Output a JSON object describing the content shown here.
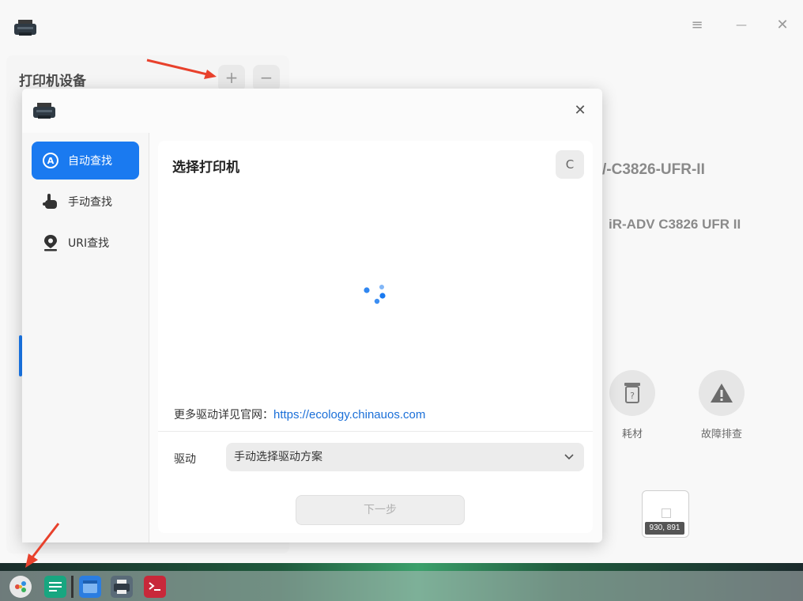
{
  "main_window": {
    "panel_title": "打印机设备",
    "add_label": "+",
    "remove_label": "−",
    "controls": {
      "menu": "≡",
      "minimize": "—",
      "close": "✕"
    },
    "background_model_line1": "/-C3826-UFR-II",
    "background_model_line2": "iR-ADV C3826 UFR II",
    "actions": [
      {
        "label": "耗材",
        "icon": "cartridge-icon"
      },
      {
        "label": "故障排查",
        "icon": "warning-icon"
      }
    ],
    "coord_readout": "930, 891"
  },
  "dialog": {
    "close_label": "✕",
    "nav": [
      {
        "label": "自动查找",
        "icon": "auto-search-icon",
        "active": true
      },
      {
        "label": "手动查找",
        "icon": "hand-pointer-icon",
        "active": false
      },
      {
        "label": "URI查找",
        "icon": "location-pin-icon",
        "active": false
      }
    ],
    "title": "选择打印机",
    "refresh_label": "C",
    "footnote_prefix": "更多驱动详见官网：",
    "footnote_link": "https://ecology.chinauos.com",
    "driver_label": "驱动",
    "driver_value": "手动选择驱动方案",
    "next_label": "下一步"
  },
  "taskbar": {
    "icons": [
      "launcher-icon",
      "file-manager-icon",
      "browser-icon",
      "printer-icon",
      "terminal-icon"
    ]
  },
  "colors": {
    "accent": "#1a7af0",
    "link": "#1a6fd8",
    "arrow": "#e8412c"
  }
}
